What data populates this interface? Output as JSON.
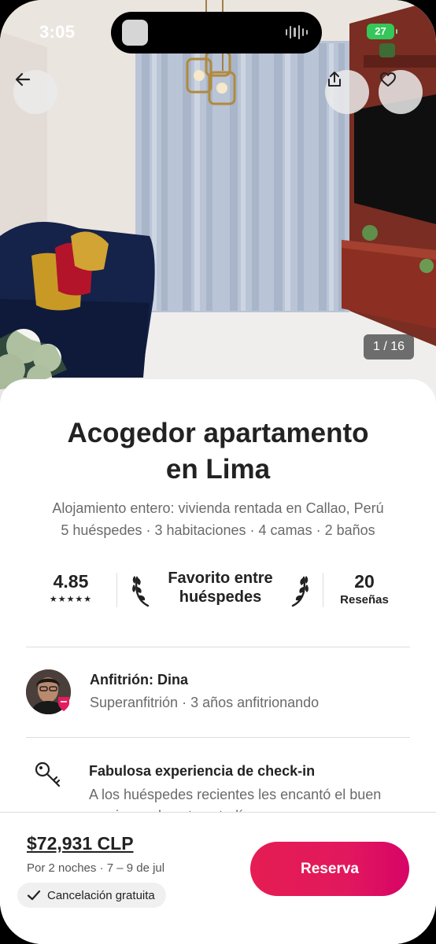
{
  "status_bar": {
    "time": "3:05",
    "battery": "27"
  },
  "gallery": {
    "counter": "1 / 16"
  },
  "listing": {
    "title_line1": "Acogedor apartamento",
    "title_line2": "en Lima",
    "subtitle_line1": "Alojamiento entero: vivienda rentada en Callao, Perú",
    "subtitle_line2": "5 huéspedes · 3 habitaciones · 4 camas · 2 baños"
  },
  "stats": {
    "rating": "4.85",
    "stars": "★★★★★",
    "favorite_line1": "Favorito entre",
    "favorite_line2": "huéspedes",
    "reviews_count": "20",
    "reviews_label": "Reseñas"
  },
  "host": {
    "name": "Anfitrión: Dina",
    "meta": "Superanfitrión · 3 años anfitrionando"
  },
  "highlight": {
    "title": "Fabulosa experiencia de check-in",
    "description": "A los huéspedes recientes les encantó el buen comienzo de esta estadía."
  },
  "footer": {
    "price": "$72,931 CLP",
    "dates": "Por 2 noches · 7 – 9 de jul",
    "cancellation": "Cancelación gratuita",
    "reserve_label": "Reserva"
  },
  "icons": {
    "back": "arrow-left-icon",
    "share": "share-icon",
    "favorite": "heart-icon",
    "key": "key-icon",
    "check": "check-icon",
    "laurel": "laurel-icon"
  },
  "colors": {
    "accent": "#E31C5F",
    "text": "#222222",
    "muted": "#6A6A6A",
    "battery": "#35C759"
  }
}
